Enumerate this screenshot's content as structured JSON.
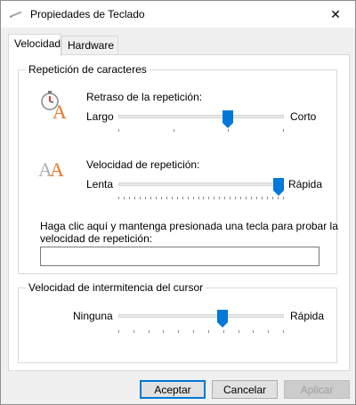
{
  "window": {
    "title": "Propiedades de Teclado",
    "close_glyph": "✕"
  },
  "tabs": [
    {
      "label": "Velocidad",
      "active": true
    },
    {
      "label": "Hardware",
      "active": false
    }
  ],
  "repeat_group": {
    "title": "Repetición de caracteres",
    "delay": {
      "label": "Retraso de la repetición:",
      "min_label": "Largo",
      "max_label": "Corto",
      "value_fraction": 0.67,
      "tick_count": 4,
      "icon": "stopwatch-letter-a-icon"
    },
    "rate": {
      "label": "Velocidad de repetición:",
      "min_label": "Lenta",
      "max_label": "Rápida",
      "value_fraction": 1.0,
      "tick_count": 32,
      "icon": "double-letter-a-icon"
    },
    "test": {
      "label_line1": "Haga clic aquí y mantenga presionada una tecla para probar la",
      "label_line2": "velocidad de repetición:",
      "value": ""
    }
  },
  "cursor_group": {
    "title": "Velocidad de intermitencia del cursor",
    "min_label": "Ninguna",
    "max_label": "Rápida",
    "value_fraction": 0.64,
    "tick_count": 12
  },
  "buttons": {
    "ok": "Aceptar",
    "cancel": "Cancelar",
    "apply": "Aplicar"
  },
  "colors": {
    "accent": "#0078d7",
    "letter_orange": "#e87722",
    "letter_gray": "#b0b0b0"
  }
}
